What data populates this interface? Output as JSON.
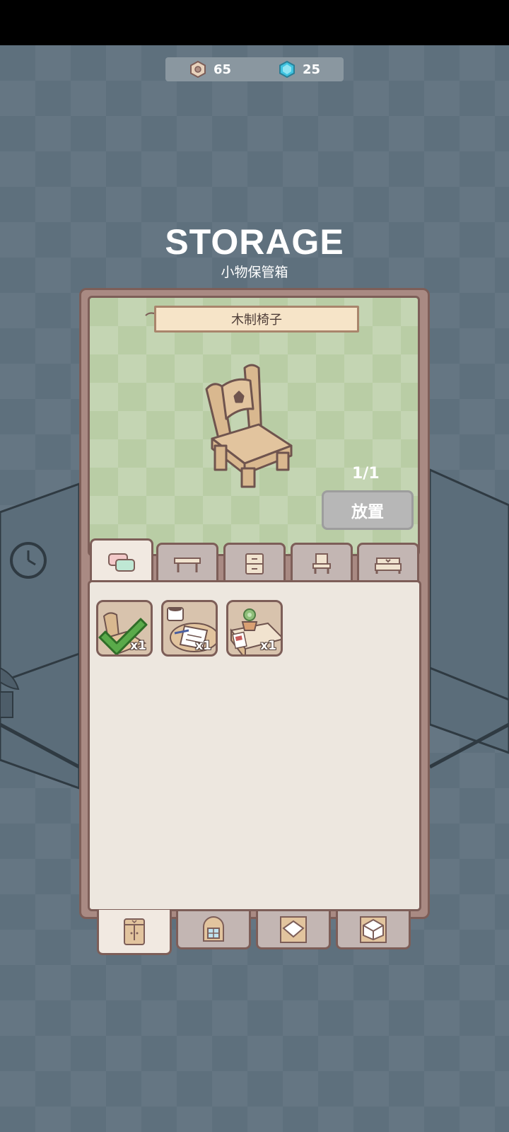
{
  "currency": {
    "coins": "65",
    "gems": "25"
  },
  "title": "STORAGE",
  "subtitle": "小物保管箱",
  "selected_item": {
    "name": "木制椅子",
    "count": "1/1",
    "place_label": "放置"
  },
  "top_tabs": [
    {
      "icon": "small-items-icon",
      "active": true
    },
    {
      "icon": "table-icon",
      "active": false
    },
    {
      "icon": "cabinet-icon",
      "active": false
    },
    {
      "icon": "chair-icon",
      "active": false
    },
    {
      "icon": "bed-icon",
      "active": false
    }
  ],
  "items": [
    {
      "name": "wooden-chair",
      "qty": "x1",
      "selected": true
    },
    {
      "name": "coffee-desk",
      "qty": "x1",
      "selected": false
    },
    {
      "name": "plant-desk",
      "qty": "x1",
      "selected": false
    }
  ],
  "bottom_tabs": [
    {
      "icon": "wardrobe-icon",
      "active": true
    },
    {
      "icon": "window-icon",
      "active": false
    },
    {
      "icon": "floor-icon",
      "active": false
    },
    {
      "icon": "wall-icon",
      "active": false
    }
  ],
  "colors": {
    "accent_green": "#5aaa4a",
    "panel_border": "#7d5e58",
    "preview_bg": "#b9cda5"
  }
}
